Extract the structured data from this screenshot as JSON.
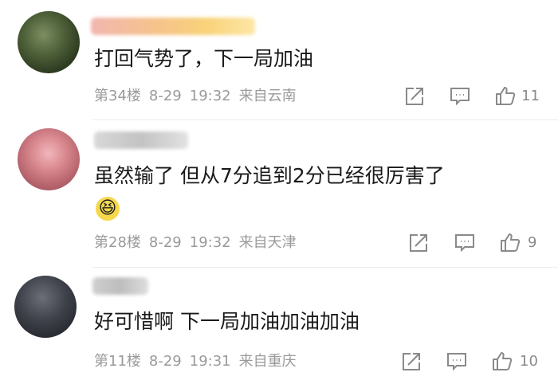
{
  "comments": [
    {
      "text": "打回气势了，下一局加油",
      "floor": "第34楼",
      "date": "8-29",
      "time": "19:32",
      "location": "来自云南",
      "likes": "11"
    },
    {
      "text": "虽然输了 但从7分追到2分已经很厉害了",
      "emoji": "😆",
      "floor": "第28楼",
      "date": "8-29",
      "time": "19:32",
      "location": "来自天津",
      "likes": "9"
    },
    {
      "text": "好可惜啊 下一局加油加油加油",
      "floor": "第11楼",
      "date": "8-29",
      "time": "19:31",
      "location": "来自重庆",
      "likes": "10"
    }
  ],
  "icons": {
    "share": "share-icon",
    "reply": "comment-icon",
    "like": "thumbs-up-icon"
  },
  "colors": {
    "meta_text": "#9a9a9a",
    "content_text": "#1a1a1a",
    "icon_stroke": "#8a8a8a"
  }
}
